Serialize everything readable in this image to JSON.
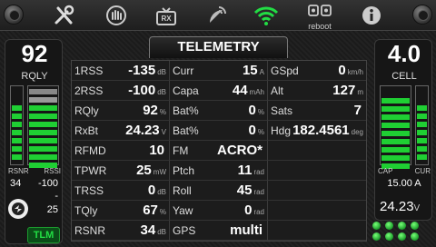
{
  "topbar": {
    "icons": [
      "tools-icon",
      "hand-icon",
      "rx-icon",
      "satellite-dish-icon",
      "wifi-icon",
      "reboot-icon",
      "info-icon"
    ],
    "rx_label": "RX",
    "reboot_label": "reboot",
    "active_icon": "wifi-icon",
    "accent_color": "#22dd44"
  },
  "left": {
    "rqly_value": "92",
    "rqly_label": "RQLY",
    "rsnr_label": "RSNR",
    "rssi_label": "RSSI",
    "rsnr_value": "34",
    "rssi_value": "-100",
    "extra_dash": "-",
    "extra_value": "25",
    "tlm_label": "TLM"
  },
  "right": {
    "cell_value": "4.0",
    "cell_label": "CELL",
    "cap_label": "CAP",
    "cur_label": "CUR",
    "current_value": "15.00 A",
    "voltage_value": "24.23",
    "voltage_unit": "V"
  },
  "title": "TELEMETRY",
  "rows": [
    [
      {
        "label": "1RSS",
        "value": "-135",
        "unit": "dB"
      },
      {
        "label": "Curr",
        "value": "15",
        "unit": "A"
      },
      {
        "label": "GSpd",
        "value": "0",
        "unit": "km/h"
      }
    ],
    [
      {
        "label": "2RSS",
        "value": "-100",
        "unit": "dB"
      },
      {
        "label": "Capa",
        "value": "44",
        "unit": "mAh"
      },
      {
        "label": "Alt",
        "value": "127",
        "unit": "m"
      }
    ],
    [
      {
        "label": "RQly",
        "value": "92",
        "unit": "%"
      },
      {
        "label": "Bat%",
        "value": "0",
        "unit": "%"
      },
      {
        "label": "Sats",
        "value": "7",
        "unit": ""
      }
    ],
    [
      {
        "label": "RxBt",
        "value": "24.23",
        "unit": "V"
      },
      {
        "label": "Bat%",
        "value": "0",
        "unit": "%"
      },
      {
        "label": "Hdg",
        "value": "182.4561",
        "unit": "deg"
      }
    ],
    [
      {
        "label": "RFMD",
        "value": "10",
        "unit": ""
      },
      {
        "label": "FM",
        "value": "ACRO*",
        "unit": ""
      },
      {
        "label": "",
        "value": "",
        "unit": ""
      }
    ],
    [
      {
        "label": "TPWR",
        "value": "25",
        "unit": "mW"
      },
      {
        "label": "Ptch",
        "value": "11",
        "unit": "rad"
      },
      {
        "label": "",
        "value": "",
        "unit": ""
      }
    ],
    [
      {
        "label": "TRSS",
        "value": "0",
        "unit": "dB"
      },
      {
        "label": "Roll",
        "value": "45",
        "unit": "rad"
      },
      {
        "label": "",
        "value": "",
        "unit": ""
      }
    ],
    [
      {
        "label": "TQly",
        "value": "67",
        "unit": "%"
      },
      {
        "label": "Yaw",
        "value": "0",
        "unit": "rad"
      },
      {
        "label": "",
        "value": "",
        "unit": ""
      }
    ],
    [
      {
        "label": "RSNR",
        "value": "34",
        "unit": "dB"
      },
      {
        "label": "GPS",
        "value": "multi",
        "unit": ""
      },
      {
        "label": "",
        "value": "",
        "unit": ""
      }
    ]
  ]
}
